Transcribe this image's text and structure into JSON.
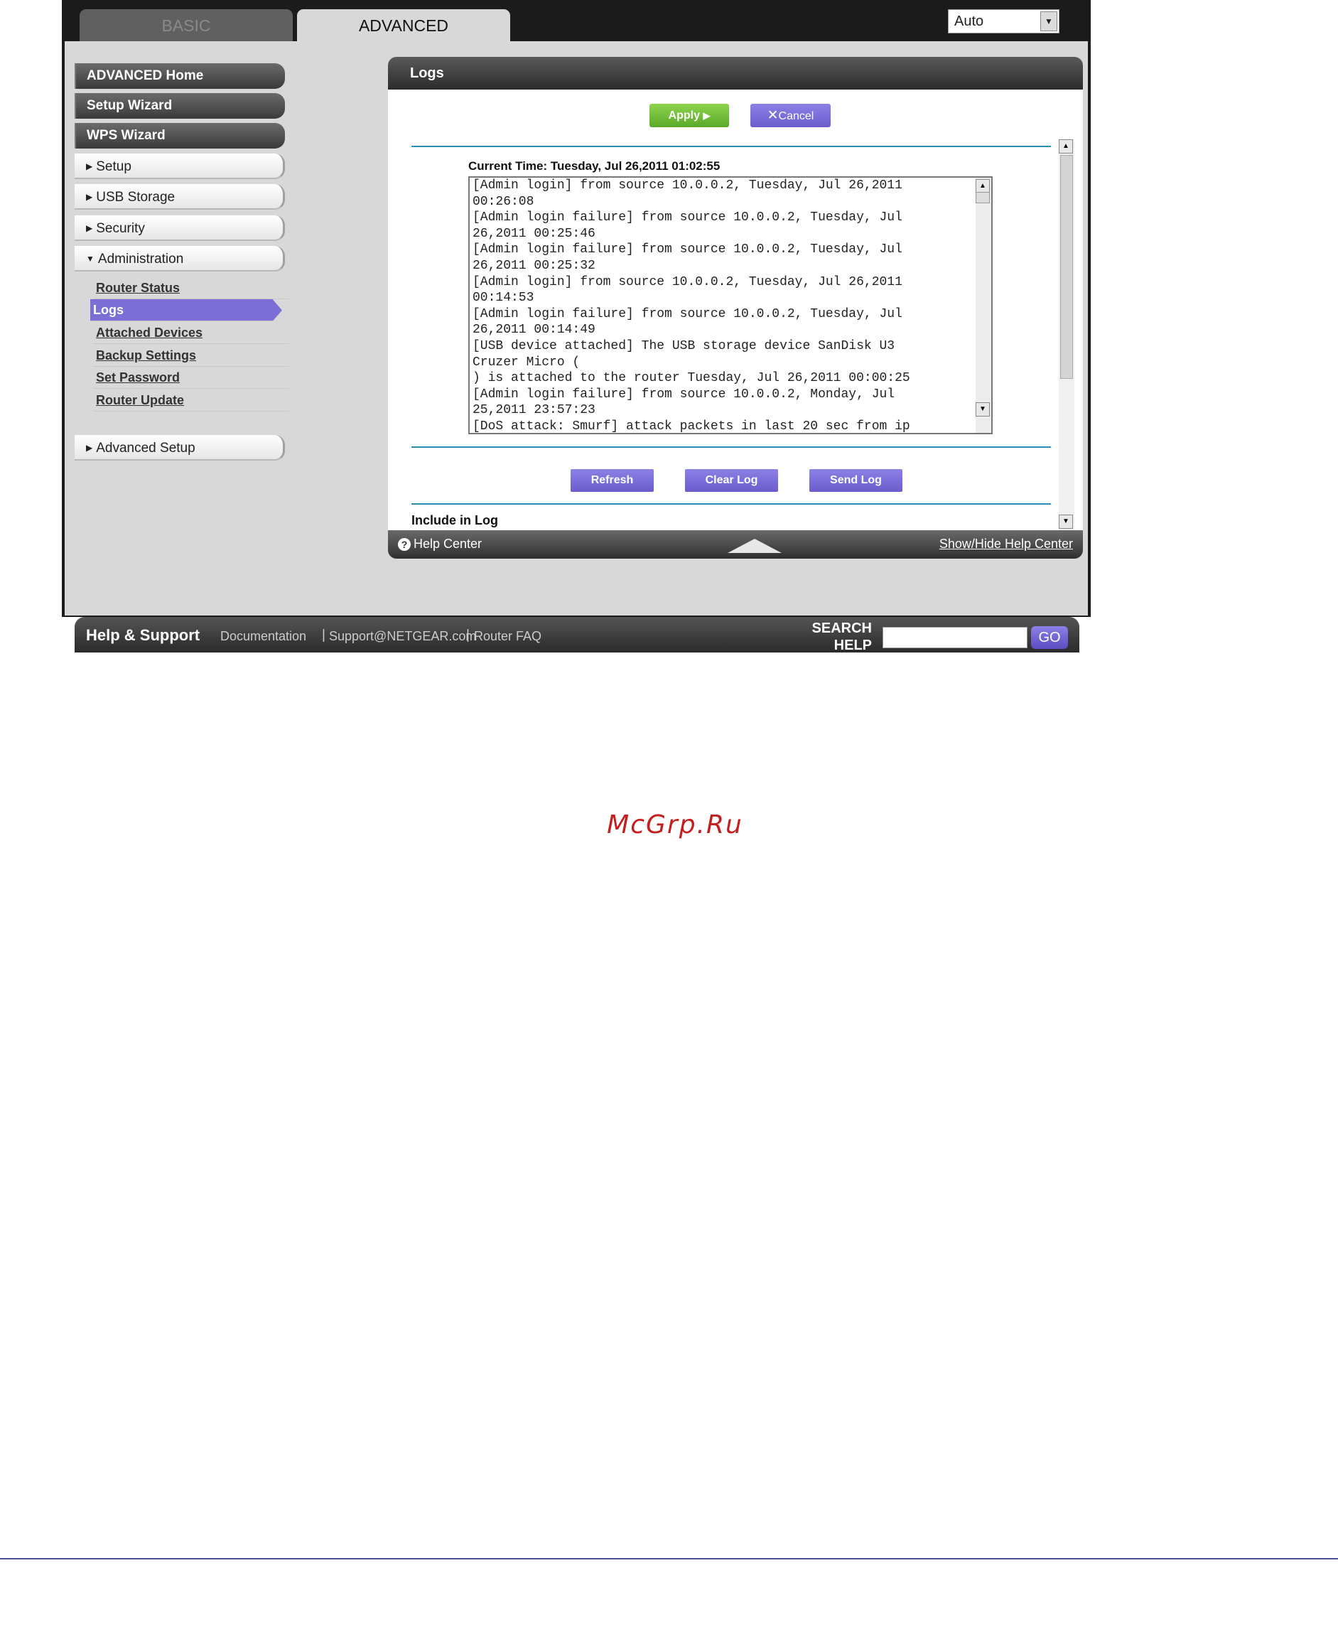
{
  "tabs": {
    "basic": "BASIC",
    "advanced": "ADVANCED"
  },
  "mode_select": {
    "value": "Auto"
  },
  "sidebar": {
    "dark_items": [
      "ADVANCED Home",
      "Setup Wizard",
      "WPS Wizard"
    ],
    "sections": [
      "Setup",
      "USB Storage",
      "Security",
      "Administration"
    ],
    "admin_items": [
      "Router Status",
      "Logs",
      "Attached Devices",
      "Backup Settings",
      "Set Password",
      "Router Update"
    ],
    "advanced_setup": "Advanced Setup"
  },
  "panel": {
    "title": "Logs",
    "apply_label": "Apply",
    "cancel_label": "Cancel",
    "current_time": "Current Time: Tuesday, Jul 26,2011 01:02:55",
    "log_text": "[Admin login] from source 10.0.0.2, Tuesday, Jul 26,2011\n00:26:08\n[Admin login failure] from source 10.0.0.2, Tuesday, Jul\n26,2011 00:25:46\n[Admin login failure] from source 10.0.0.2, Tuesday, Jul\n26,2011 00:25:32\n[Admin login] from source 10.0.0.2, Tuesday, Jul 26,2011\n00:14:53\n[Admin login failure] from source 10.0.0.2, Tuesday, Jul\n26,2011 00:14:49\n[USB device attached] The USB storage device SanDisk U3\nCruzer Micro (\n) is attached to the router Tuesday, Jul 26,2011 00:00:25\n[Admin login failure] from source 10.0.0.2, Monday, Jul\n25,2011 23:57:23\n[DoS attack: Smurf] attack packets in last 20 sec from ip",
    "refresh_label": "Refresh",
    "clear_log_label": "Clear Log",
    "send_log_label": "Send Log",
    "include_in_log": "Include in Log"
  },
  "help_bar": {
    "help_center": "Help Center",
    "show_hide": "Show/Hide Help Center"
  },
  "footer": {
    "title": "Help & Support",
    "links": [
      "Documentation",
      "Support@NETGEAR.com",
      "Router FAQ"
    ],
    "search_label_line1": "SEARCH",
    "search_label_line2": "HELP",
    "search_value": "",
    "go_label": "GO"
  },
  "watermark": "McGrp.Ru",
  "icons": {
    "help": "question-circle-icon",
    "apply": "play-arrow-icon",
    "cancel": "close-x-icon",
    "dropdown": "chevron-down-icon",
    "collapse": "triangle-up-icon"
  }
}
